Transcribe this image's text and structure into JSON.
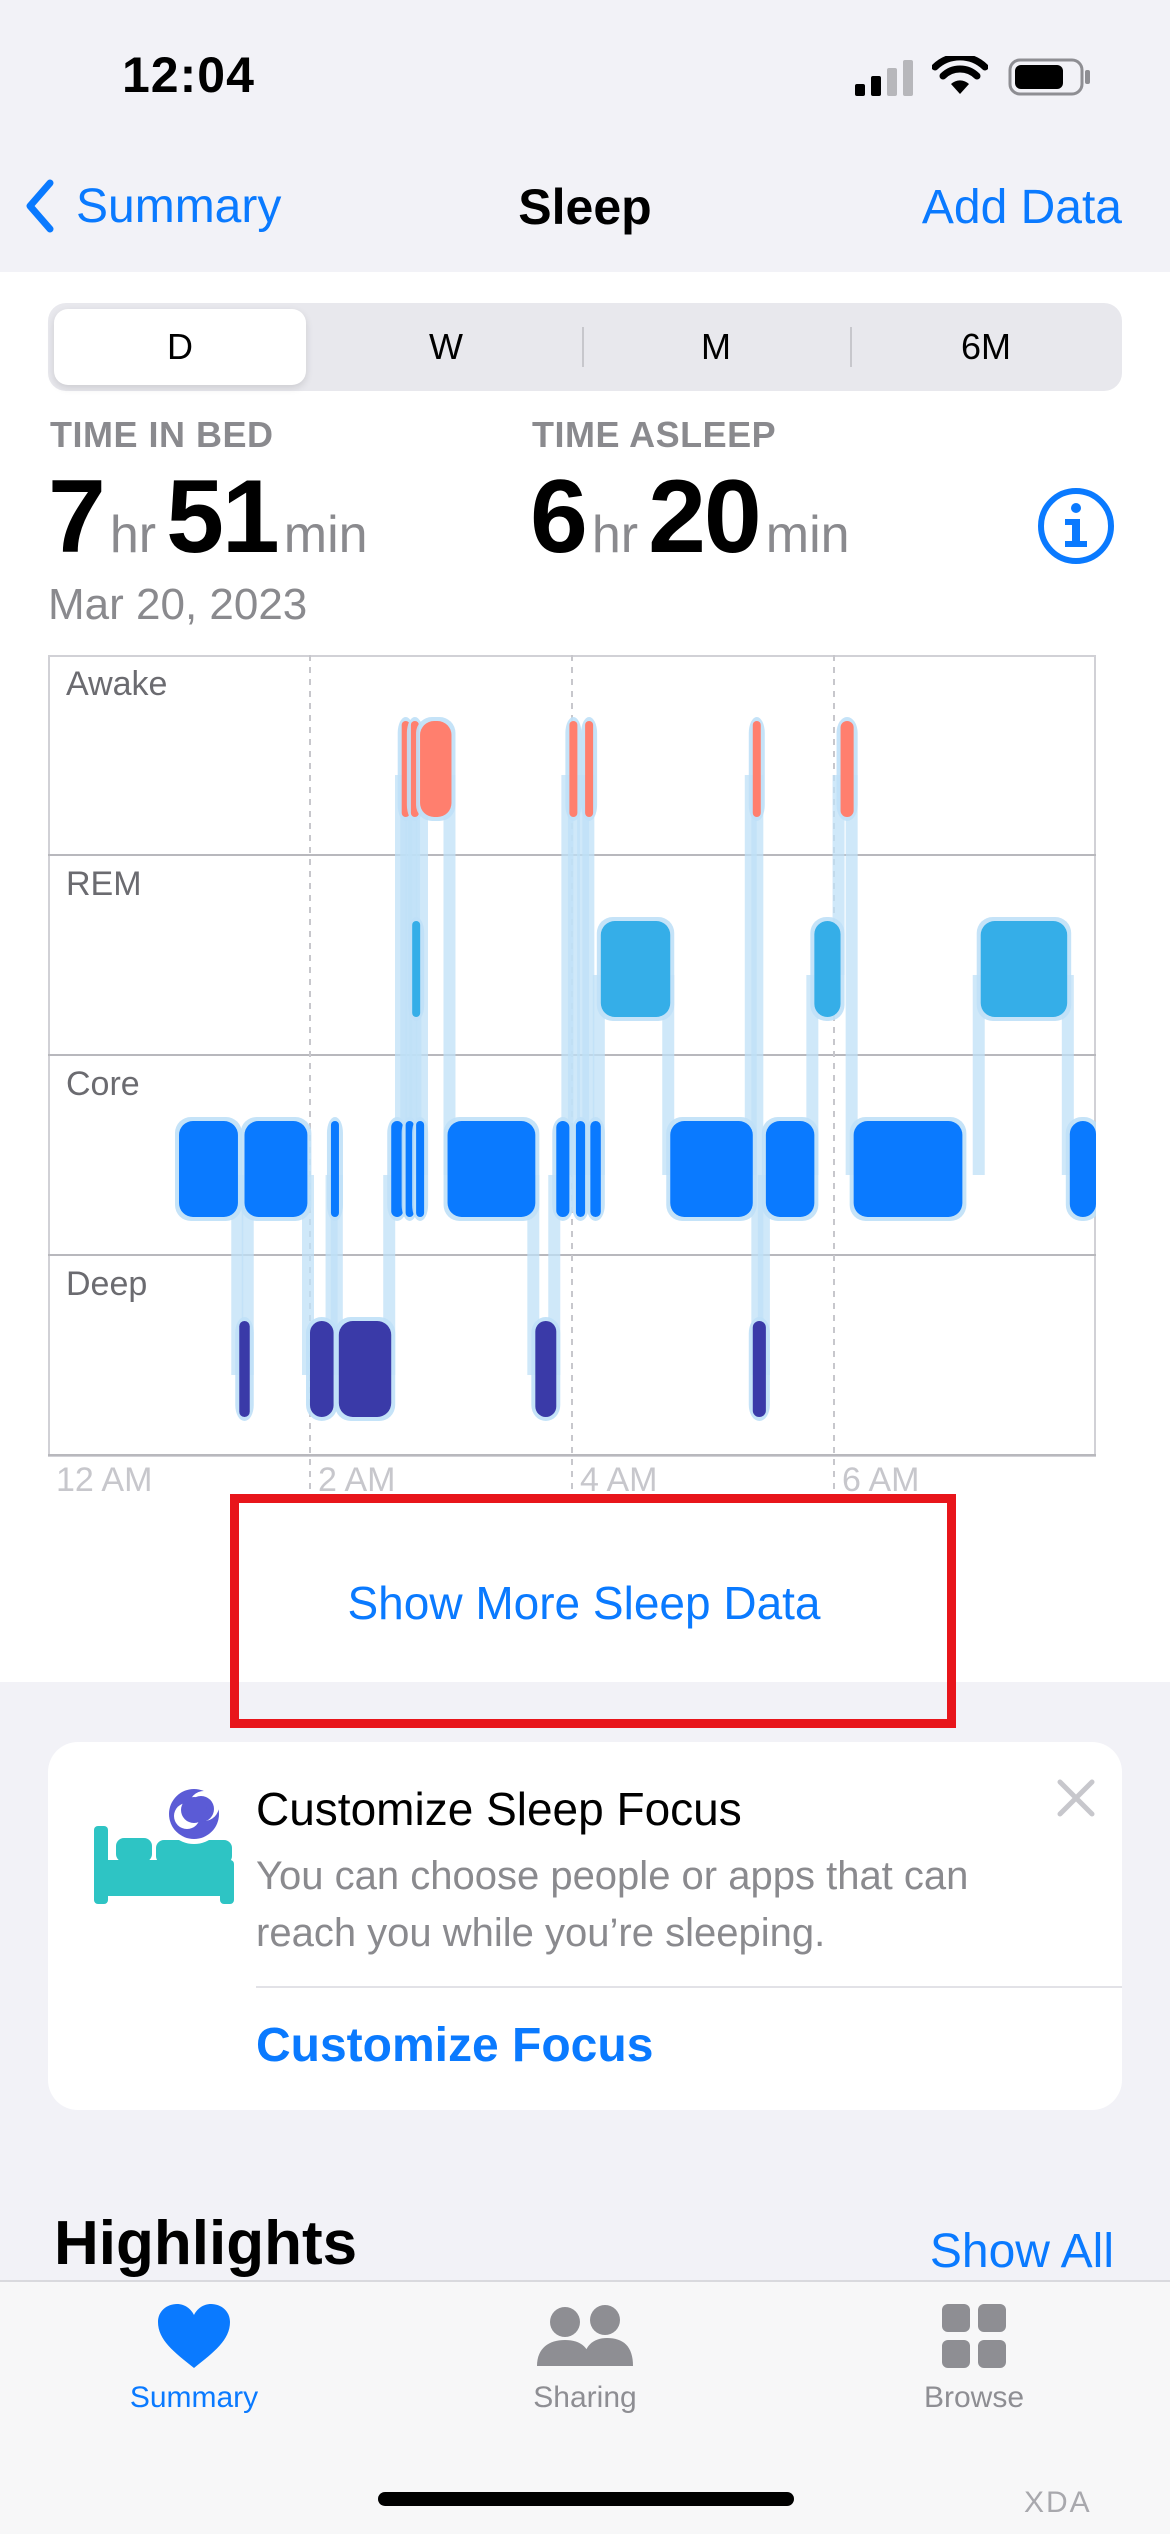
{
  "status_bar": {
    "time": "12:04"
  },
  "nav": {
    "back_label": "Summary",
    "title": "Sleep",
    "action_label": "Add Data"
  },
  "segments": [
    {
      "label": "D",
      "active": true
    },
    {
      "label": "W",
      "active": false
    },
    {
      "label": "M",
      "active": false
    },
    {
      "label": "6M",
      "active": false
    }
  ],
  "stats": {
    "time_in_bed": {
      "label": "TIME IN BED",
      "hours": "7",
      "hours_unit": "hr",
      "minutes": "51",
      "minutes_unit": "min"
    },
    "time_asleep": {
      "label": "TIME ASLEEP",
      "hours": "6",
      "hours_unit": "hr",
      "minutes": "20",
      "minutes_unit": "min"
    },
    "date": "Mar 20, 2023"
  },
  "chart_data": {
    "type": "sleep-stage-timeline",
    "stages": [
      "Awake",
      "REM",
      "Core",
      "Deep"
    ],
    "x_range_hours": [
      0,
      8
    ],
    "tick_labels": [
      {
        "label": "12 AM",
        "hour": 0
      },
      {
        "label": "2 AM",
        "hour": 2
      },
      {
        "label": "4 AM",
        "hour": 4
      },
      {
        "label": "6 AM",
        "hour": 6
      }
    ],
    "colors": {
      "Awake": "#ff7f6e",
      "REM": "#35aee8",
      "Core": "#0a7aff",
      "Deep": "#3a3aa8",
      "connector": "#bfe0f7"
    },
    "segments": [
      {
        "stage": "Core",
        "start": 1.0,
        "end": 1.45
      },
      {
        "stage": "Core",
        "start": 1.5,
        "end": 1.98
      },
      {
        "stage": "Deep",
        "start": 1.46,
        "end": 1.54
      },
      {
        "stage": "Deep",
        "start": 2.0,
        "end": 2.18
      },
      {
        "stage": "Core",
        "start": 2.16,
        "end": 2.22
      },
      {
        "stage": "Deep",
        "start": 2.22,
        "end": 2.62
      },
      {
        "stage": "Core",
        "start": 2.62,
        "end": 2.71
      },
      {
        "stage": "Core",
        "start": 2.73,
        "end": 2.79
      },
      {
        "stage": "Core",
        "start": 2.81,
        "end": 2.87
      },
      {
        "stage": "Awake",
        "start": 2.7,
        "end": 2.75
      },
      {
        "stage": "Awake",
        "start": 2.77,
        "end": 2.81
      },
      {
        "stage": "Awake",
        "start": 2.84,
        "end": 3.08
      },
      {
        "stage": "REM",
        "start": 2.78,
        "end": 2.82
      },
      {
        "stage": "Core",
        "start": 3.05,
        "end": 3.72
      },
      {
        "stage": "Deep",
        "start": 3.72,
        "end": 3.88
      },
      {
        "stage": "Core",
        "start": 3.88,
        "end": 3.98
      },
      {
        "stage": "Awake",
        "start": 3.98,
        "end": 4.03
      },
      {
        "stage": "Core",
        "start": 4.03,
        "end": 4.1
      },
      {
        "stage": "Awake",
        "start": 4.1,
        "end": 4.14
      },
      {
        "stage": "Core",
        "start": 4.14,
        "end": 4.22
      },
      {
        "stage": "REM",
        "start": 4.22,
        "end": 4.75
      },
      {
        "stage": "Core",
        "start": 4.75,
        "end": 5.38
      },
      {
        "stage": "Awake",
        "start": 5.38,
        "end": 5.43
      },
      {
        "stage": "Deep",
        "start": 5.38,
        "end": 5.48
      },
      {
        "stage": "Core",
        "start": 5.48,
        "end": 5.85
      },
      {
        "stage": "REM",
        "start": 5.85,
        "end": 6.05
      },
      {
        "stage": "Awake",
        "start": 6.05,
        "end": 6.15
      },
      {
        "stage": "Core",
        "start": 6.15,
        "end": 6.98
      },
      {
        "stage": "REM",
        "start": 7.12,
        "end": 7.78
      },
      {
        "stage": "Core",
        "start": 7.8,
        "end": 8.0
      }
    ]
  },
  "show_more_label": "Show More Sleep Data",
  "focus_card": {
    "title": "Customize Sleep Focus",
    "description": "You can choose people or apps that can reach you while you’re sleeping.",
    "action_label": "Customize Focus"
  },
  "highlights": {
    "title": "Highlights",
    "action_label": "Show All"
  },
  "tab_bar": [
    {
      "label": "Summary",
      "icon": "heart-icon",
      "active": true
    },
    {
      "label": "Sharing",
      "icon": "people-icon",
      "active": false
    },
    {
      "label": "Browse",
      "icon": "grid-icon",
      "active": false
    }
  ],
  "watermark": "XDA"
}
